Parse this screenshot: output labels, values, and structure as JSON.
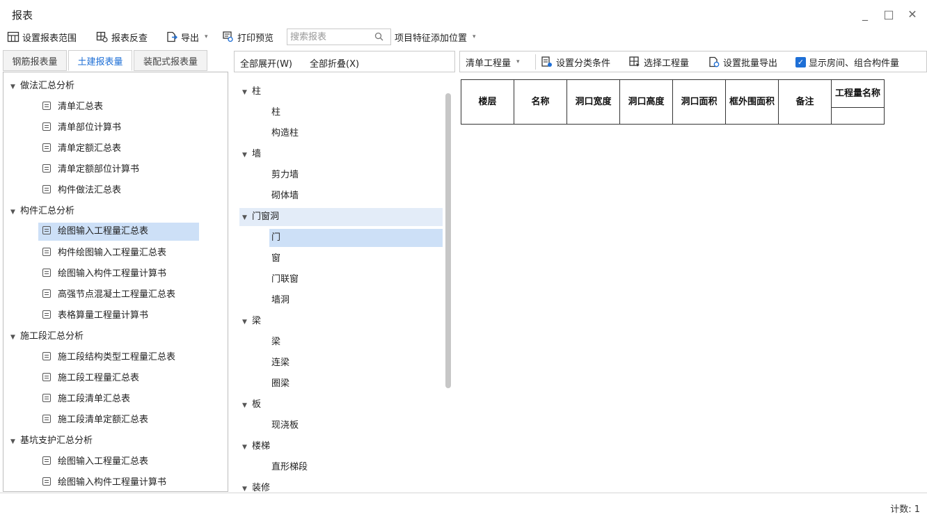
{
  "window": {
    "title": "报表",
    "minimize": "_",
    "maximize": "□",
    "close": "✕"
  },
  "toolbar": {
    "set_range": "设置报表范围",
    "reverse_check": "报表反查",
    "export": "导出",
    "print_preview": "打印预览",
    "search_placeholder": "搜索报表",
    "project_feature": "项目特征添加位置"
  },
  "left_tabs": [
    {
      "label": "钢筋报表量",
      "active": false
    },
    {
      "label": "土建报表量",
      "active": true
    },
    {
      "label": "装配式报表量",
      "active": false
    }
  ],
  "left_tree": {
    "groups": [
      {
        "label": "做法汇总分析",
        "items": [
          "清单汇总表",
          "清单部位计算书",
          "清单定额汇总表",
          "清单定额部位计算书",
          "构件做法汇总表"
        ]
      },
      {
        "label": "构件汇总分析",
        "items": [
          "绘图输入工程量汇总表",
          "构件绘图输入工程量汇总表",
          "绘图输入构件工程量计算书",
          "高强节点混凝土工程量汇总表",
          "表格算量工程量计算书"
        ]
      },
      {
        "label": "施工段汇总分析",
        "items": [
          "施工段结构类型工程量汇总表",
          "施工段工程量汇总表",
          "施工段清单汇总表",
          "施工段清单定额汇总表"
        ]
      },
      {
        "label": "基坑支护汇总分析",
        "items": [
          "绘图输入工程量汇总表",
          "绘图输入构件工程量计算书"
        ]
      }
    ],
    "selected": "绘图输入工程量汇总表"
  },
  "mid_header": {
    "expand_all": "全部展开(W)",
    "collapse_all": "全部折叠(X)"
  },
  "mid_tree": {
    "groups": [
      {
        "label": "柱",
        "items": [
          "柱",
          "构造柱"
        ]
      },
      {
        "label": "墙",
        "items": [
          "剪力墙",
          "砌体墙"
        ]
      },
      {
        "label": "门窗洞",
        "items": [
          "门",
          "窗",
          "门联窗",
          "墙洞"
        ]
      },
      {
        "label": "梁",
        "items": [
          "梁",
          "连梁",
          "圈梁"
        ]
      },
      {
        "label": "板",
        "items": [
          "现浇板"
        ]
      },
      {
        "label": "楼梯",
        "items": [
          "直形梯段"
        ]
      },
      {
        "label": "装修",
        "items": []
      }
    ],
    "selected_group": "门窗洞",
    "selected_item": "门"
  },
  "right_toolbar": {
    "qty_type": "清单工程量",
    "set_category": "设置分类条件",
    "select_qty": "选择工程量",
    "batch_export": "设置批量导出",
    "show_rooms": "显示房间、组合构件量"
  },
  "table": {
    "headers": [
      "楼层",
      "名称",
      "洞口宽度",
      "洞口高度",
      "洞口面积",
      "框外围面积",
      "备注",
      "工程量名称"
    ]
  },
  "status": {
    "count": "计数: 1"
  },
  "colors": {
    "accent": "#1e6fd6",
    "selection": "#cde0f7"
  }
}
